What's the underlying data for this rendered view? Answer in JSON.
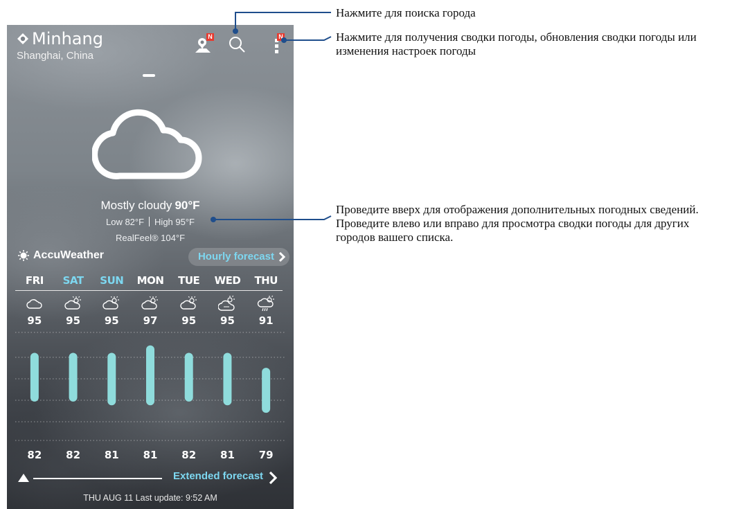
{
  "location": {
    "name": "Minhang",
    "region": "Shanghai, China"
  },
  "badges": {
    "map": "N",
    "menu": "N"
  },
  "current": {
    "condition": "Mostly cloudy",
    "temp": "90°F",
    "low": "Low 82°F",
    "high": "High 95°F",
    "realfeel": "RealFeel® 104°F"
  },
  "provider": "AccuWeather",
  "hourly_label": "Hourly forecast",
  "extended_label": "Extended forecast",
  "last_update": "THU AUG 11 Last update: 9:52 AM",
  "accent": "#7dd7f0",
  "bar_color": "#8fdcdc",
  "forecast": [
    {
      "day": "FRI",
      "weekend": false,
      "icon": "cloud-icon",
      "high": "95",
      "low": "82"
    },
    {
      "day": "SAT",
      "weekend": true,
      "icon": "partly-sunny-icon",
      "high": "95",
      "low": "82"
    },
    {
      "day": "SUN",
      "weekend": true,
      "icon": "partly-sunny-icon",
      "high": "95",
      "low": "81"
    },
    {
      "day": "MON",
      "weekend": false,
      "icon": "partly-sunny-icon",
      "high": "97",
      "low": "81"
    },
    {
      "day": "TUE",
      "weekend": false,
      "icon": "partly-sunny-icon",
      "high": "95",
      "low": "82"
    },
    {
      "day": "WED",
      "weekend": false,
      "icon": "mostly-cloudy-sun-icon",
      "high": "95",
      "low": "81"
    },
    {
      "day": "THU",
      "weekend": false,
      "icon": "thunderstorm-sun-icon",
      "high": "91",
      "low": "79"
    }
  ],
  "annotations": {
    "search": "Нажмите для поиска города",
    "menu": "Нажмите для получения сводки погоды, обновления сводки погоды или изменения настроек погоды",
    "swipe_up": "Проведите вверх для отображения дополнительных погодных сведений.",
    "swipe_side": "Проведите влево или вправо для просмотра сводки погоды для других городов вашего списка."
  }
}
